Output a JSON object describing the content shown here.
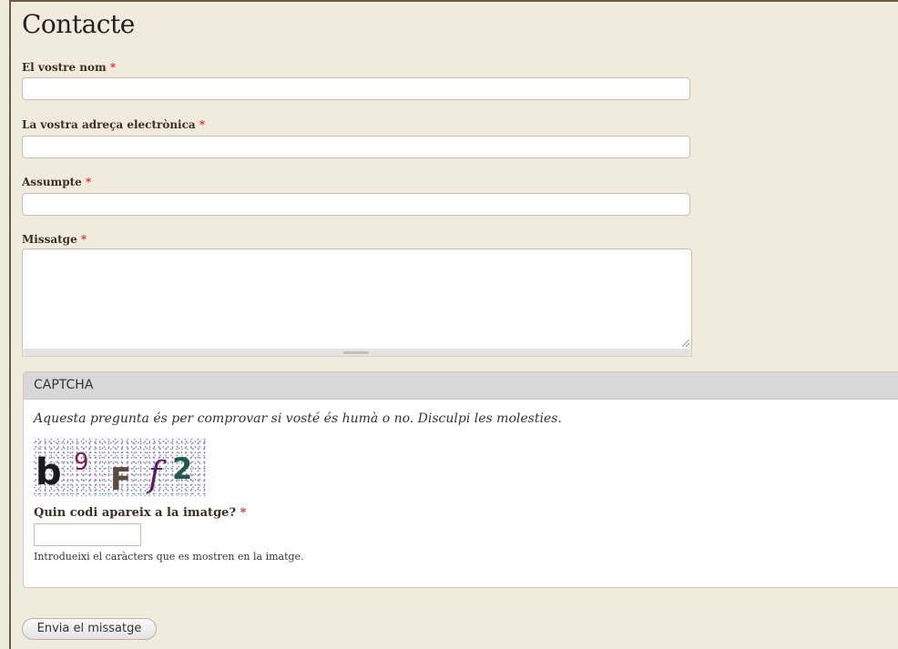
{
  "page": {
    "title": "Contacte"
  },
  "form": {
    "name_label": "El vostre nom",
    "email_label": "La vostra adreça electrònica",
    "subject_label": "Assumpte",
    "message_label": "Missatge",
    "required_marker": "*",
    "name_value": "",
    "email_value": "",
    "subject_value": "",
    "message_value": ""
  },
  "captcha": {
    "legend": "CAPTCHA",
    "description": "Aquesta pregunta és per comprovar si vosté és humà o no. Disculpi les molesties.",
    "image_text": "b9Ff2",
    "question_label": "Quin codi apareix a la imatge?",
    "answer_value": "",
    "help_text": "Introdueixi el caràcters que es mostren en la imatge."
  },
  "actions": {
    "submit_label": "Envia el missatge"
  },
  "colors": {
    "background": "#f1ebdd",
    "required": "#d0332a",
    "legend_bg": "#d8d8d8"
  }
}
